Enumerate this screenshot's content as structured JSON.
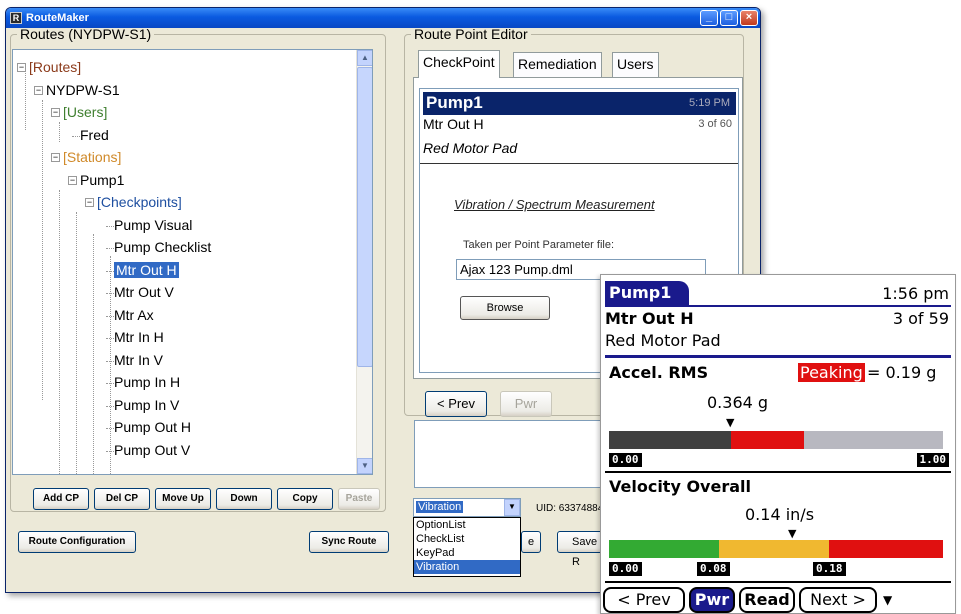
{
  "window": {
    "title": "RouteMaker"
  },
  "routes": {
    "group_title": "Routes (NYDPW-S1)",
    "tree": [
      {
        "label": "[Routes]",
        "color": "#8b3a1a"
      },
      {
        "label": "NYDPW-S1",
        "color": "#000000"
      },
      {
        "label": "[Users]",
        "color": "#3f7f2f"
      },
      {
        "label": "Fred",
        "color": "#000000"
      },
      {
        "label": "[Stations]",
        "color": "#d08a2a"
      },
      {
        "label": "Pump1",
        "color": "#000000"
      },
      {
        "label": "[Checkpoints]",
        "color": "#1e4fa0"
      },
      {
        "label": "Pump Visual",
        "color": "#000000"
      },
      {
        "label": "Pump Checklist",
        "color": "#000000"
      },
      {
        "label": "Mtr Out H",
        "color": "#000000",
        "selected": true
      },
      {
        "label": "Mtr Out V",
        "color": "#000000"
      },
      {
        "label": "Mtr Ax",
        "color": "#000000"
      },
      {
        "label": "Mtr In H",
        "color": "#000000"
      },
      {
        "label": "Mtr In V",
        "color": "#000000"
      },
      {
        "label": "Pump In H",
        "color": "#000000"
      },
      {
        "label": "Pump In V",
        "color": "#000000"
      },
      {
        "label": "Pump Out H",
        "color": "#000000"
      },
      {
        "label": "Pump Out V",
        "color": "#000000"
      }
    ],
    "buttons": {
      "add_cp": "Add CP",
      "del_cp": "Del CP",
      "move_up": "Move Up",
      "down": "Down",
      "copy": "Copy",
      "paste": "Paste"
    },
    "route_configuration": "Route Configuration",
    "sync_route": "Sync Route"
  },
  "editor": {
    "group_title": "Route Point Editor",
    "tabs": [
      "CheckPoint",
      "Remediation",
      "Users"
    ],
    "checkpoint": {
      "name": "Pump1",
      "time": "5:19 PM",
      "point": "Mtr Out H",
      "count": "3 of 60",
      "location": "Red Motor Pad",
      "measurement_link": "Vibration / Spectrum Measurement",
      "param_label": "Taken per Point Parameter file:",
      "param_file": "Ajax 123 Pump.dml",
      "browse": "Browse"
    },
    "prev": "< Prev",
    "pwr": "Pwr",
    "combo_value": "Vibration",
    "combo_options": [
      "OptionList",
      "CheckList",
      "KeyPad",
      "Vibration"
    ],
    "uid_label": "UID: 63374884",
    "save_label": "Save R",
    "partial_btn": "e"
  },
  "handheld": {
    "station": "Pump1",
    "time": "1:56 pm",
    "point": "Mtr Out H",
    "count": "3 of 59",
    "location": "Red Motor Pad",
    "accel": {
      "title": "Accel. RMS",
      "peaking_label": "Peaking",
      "peaking_value": "= 0.19 g",
      "reading": "0.364 g",
      "scale_min": "0.00",
      "scale_max": "1.00",
      "reading_fraction": 0.364
    },
    "velocity": {
      "title": "Velocity Overall",
      "reading": "0.14 in/s",
      "scale_labels": [
        "0.00",
        "0.08",
        "0.18"
      ],
      "reading_fraction": 0.55
    },
    "buttons": {
      "prev": "< Prev",
      "pwr": "Pwr",
      "read": "Read",
      "next": "Next >"
    },
    "colors": {
      "dark": "#404040",
      "red": "#e01010",
      "gray": "#b8b8c0",
      "green": "#33aa33",
      "yellow": "#f0b830",
      "navy": "#1a1a8c"
    }
  }
}
